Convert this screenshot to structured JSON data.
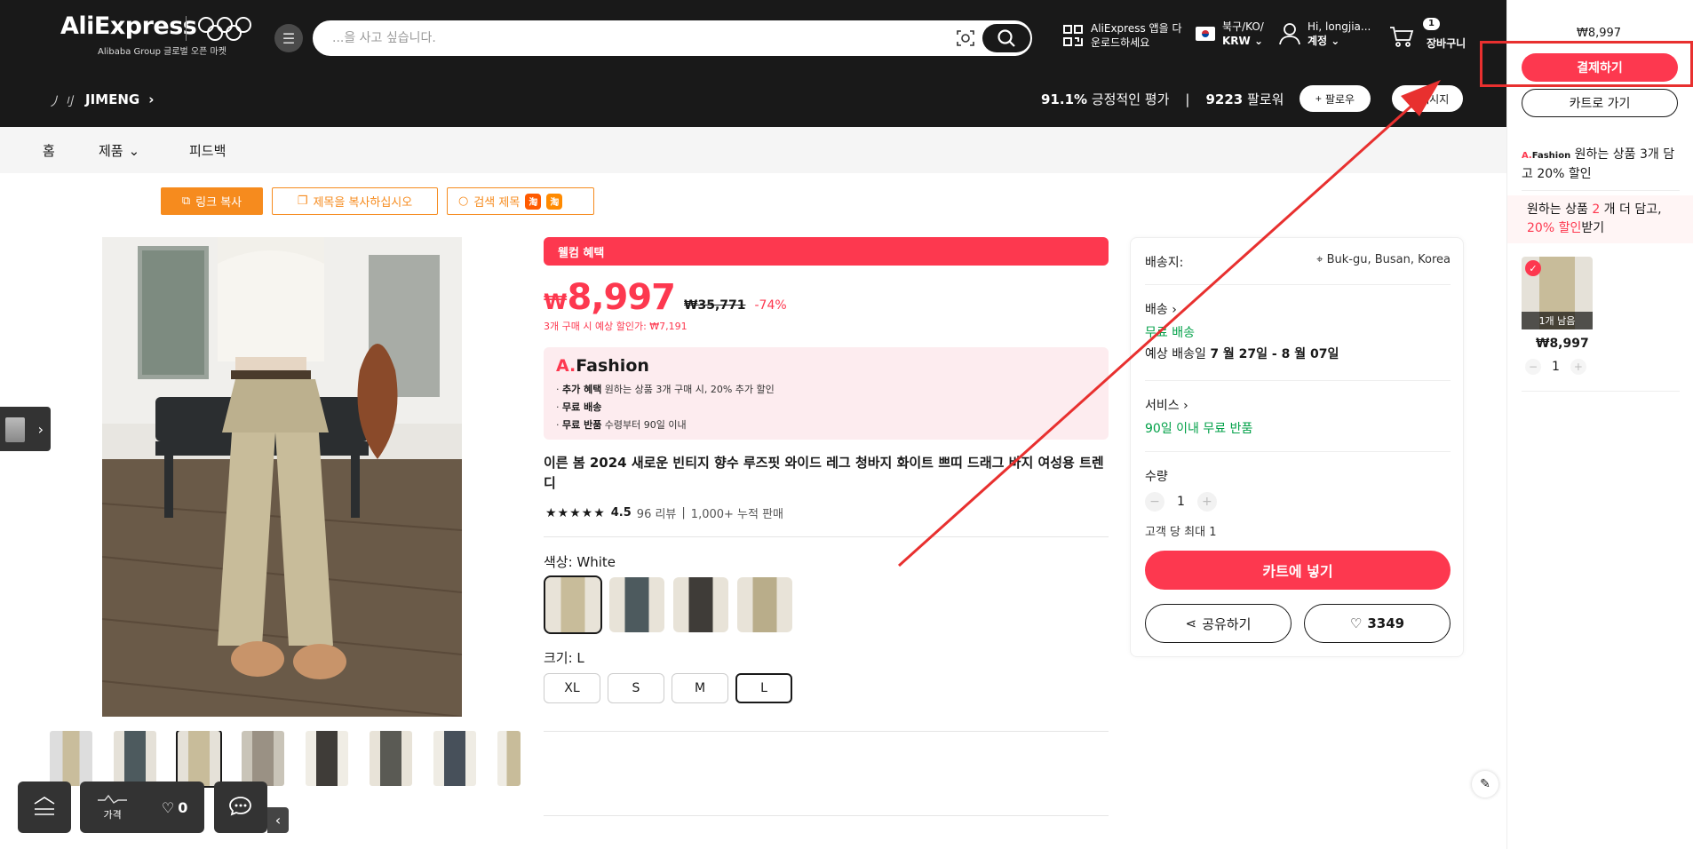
{
  "header": {
    "logo": "AliExpress",
    "logo_sub": "Alibaba Group 글로벌 오픈 마켓",
    "search_placeholder": "...을 사고 싶습니다.",
    "app_download_line1": "AliExpress 앱을 다",
    "app_download_line2": "운로드하세요",
    "region_line1": "북구/KO/",
    "region_line2": "KRW",
    "account_line1": "Hi, longjia...",
    "account_line2": "계정",
    "cart_count": "1",
    "cart_label": "장바구니"
  },
  "store": {
    "logo_text": "丿刂",
    "name": "JIMENG",
    "positive_rate": "91.1%",
    "positive_label": "긍정적인 평가",
    "followers": "9223",
    "followers_label": "팔로워",
    "separator": "|",
    "follow_label": "팔로우",
    "message_label": "메시지"
  },
  "subnav": {
    "home": "홈",
    "products": "제품",
    "feedback": "피드백"
  },
  "copy_tools": {
    "copy_link": "링크 복사",
    "copy_title": "제목을 복사하십시오",
    "search_title": "검색 제목",
    "search_logo_1": "淘",
    "search_logo_2": "淘"
  },
  "product": {
    "welcome": "웰컴 혜택",
    "currency": "₩",
    "price": "8,997",
    "original_price": "₩35,771",
    "discount": "-74%",
    "bundle_note": "3개 구매 시 예상 할인가: ₩7,191",
    "promo_brand_a": "A.",
    "promo_brand_rest": "Fashion",
    "promo_lines": [
      {
        "bold": "추가 혜택",
        "rest": " 원하는 상품 3개 구매 시, 20% 추가 할인"
      },
      {
        "bold": "무료 배송",
        "rest": ""
      },
      {
        "bold": "무료 반품",
        "rest": " 수령부터 90일 이내"
      }
    ],
    "title": "이른 봄 2024 새로운 빈티지 향수 루즈핏 와이드 레그 청바지 화이트 쁘띠 드래그 바지 여성용 트렌디",
    "stars": "★★★★★",
    "rating": "4.5",
    "reviews": "96 리뷰",
    "sold_separator": "|",
    "sold": "1,000+ 누적 판매",
    "color_label": "색상: White",
    "size_label": "크기: L",
    "sizes": [
      "XL",
      "S",
      "M",
      "L"
    ]
  },
  "shipping": {
    "ship_to_label": "배송지:",
    "ship_to_value": "Buk-gu, Busan, Korea",
    "delivery_label": "배송",
    "free_shipping": "무료 배송",
    "eta_label": "예상 배송일",
    "eta_value": "7 월 27일 - 8 월 07일",
    "service_label": "서비스",
    "return_policy": "90일 이내 무료 반품",
    "qty_label": "수량",
    "qty_value": "1",
    "qty_minus": "−",
    "qty_plus": "+",
    "limit_label": "고객 당 최대 1",
    "add_to_cart": "카트에 넣기",
    "share": "공유하기",
    "wishlist_count": "3349"
  },
  "right_panel": {
    "total": "₩8,997",
    "checkout": "결제하기",
    "go_cart": "카트로 가기",
    "promo_brand_a": "A.",
    "promo_brand_rest": "Fashion",
    "promo_text": " 원하는 상품 3개 담고 20% 할인",
    "tip_part1": "원하는 상품 ",
    "tip_num": "2",
    "tip_part2": " 개 더 담고, ",
    "tip_discount": "20% 할인",
    "tip_part3": "받기",
    "item_left": "1개 남음",
    "item_price": "₩8,997",
    "item_qty": "1",
    "qty_minus": "−",
    "qty_plus": "+"
  },
  "bottom_toolbar": {
    "price_label": "가격",
    "wish_count": "0"
  },
  "colors": {
    "brand_red": "#fd384f",
    "header_bg": "#191919",
    "orange": "#f68b1e",
    "green": "#00a047",
    "annotation_red": "#e8302f"
  }
}
